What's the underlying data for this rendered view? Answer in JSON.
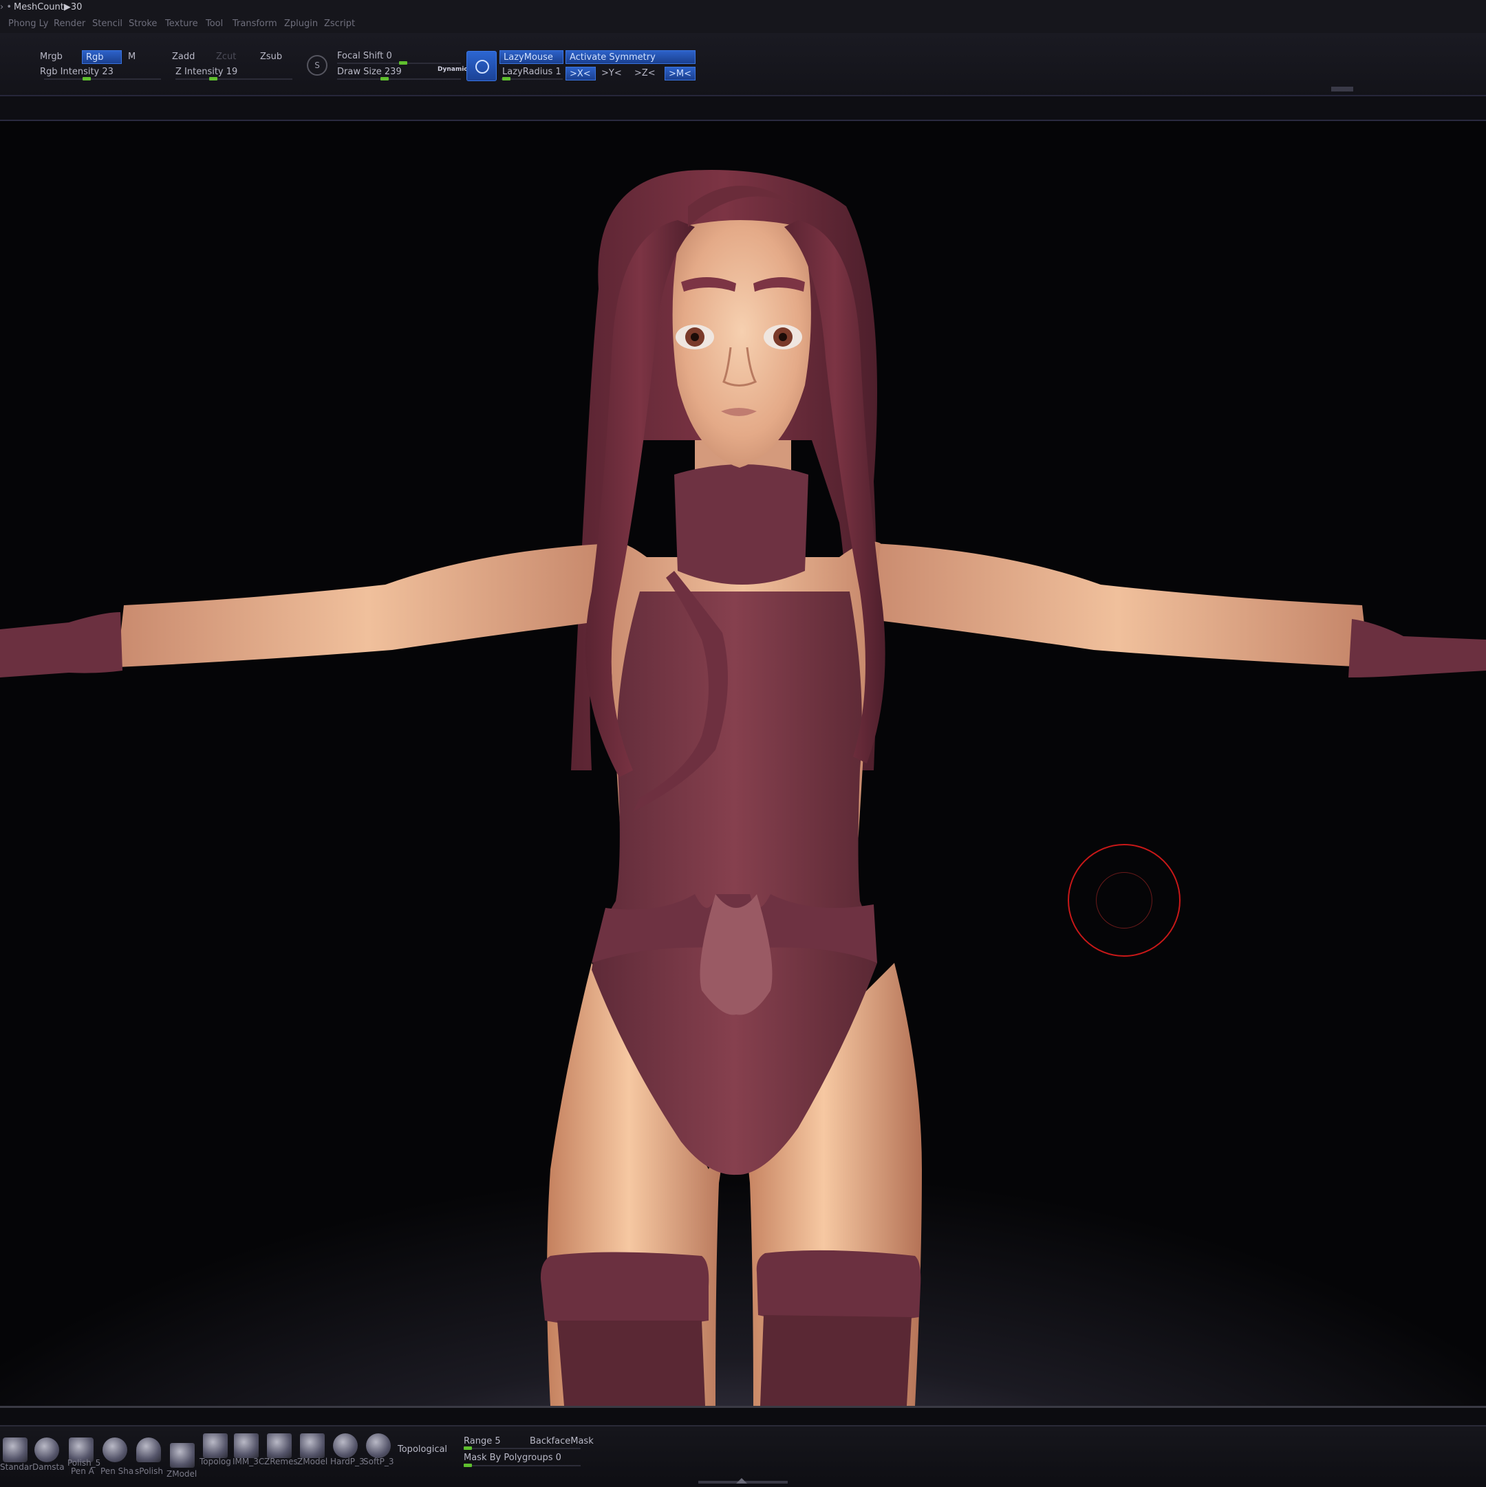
{
  "title": {
    "meshcount": "MeshCount▶30"
  },
  "menu": [
    "Phong Ly",
    "Render",
    "Stencil",
    "Stroke",
    "Texture",
    "Tool",
    "Transform",
    "Zplugin",
    "Zscript"
  ],
  "toolbar": {
    "mrgb": "Mrgb",
    "rgb": "Rgb",
    "m": "M",
    "zadd": "Zadd",
    "zcut": "Zcut",
    "zsub": "Zsub",
    "rgb_intensity": "Rgb Intensity 23",
    "z_intensity": "Z Intensity 19",
    "focal_shift": "Focal Shift 0",
    "draw_size": "Draw Size 239",
    "dynamic": "Dynamic",
    "lazymouse": "LazyMouse",
    "lazyradius": "LazyRadius 1",
    "activate_symmetry": "Activate Symmetry",
    "sym_x": ">X<",
    "sym_y": ">Y<",
    "sym_z": ">Z<",
    "sym_m": ">M<"
  },
  "sliders": {
    "rgb_intensity": 0.23,
    "z_intensity": 0.19,
    "focal_shift": 0.5,
    "draw_size": 0.2,
    "lazyradius": 0.02
  },
  "bottom": {
    "brushes": [
      "Standar",
      "Damsta",
      "Polish_5",
      "Pen A",
      "Pen Sha",
      "sPolish",
      "ZModel",
      "Topolog",
      "IMM_3C",
      "ZRemes",
      "ZModel",
      "HardP_3",
      "SoftP_3"
    ],
    "topological": "Topological",
    "range": "Range 5",
    "backfacemask": "BackfaceMask",
    "mask_by_polygroups": "Mask By Polygroups 0"
  },
  "colors": {
    "accent": "#2d62c9",
    "slider_knob": "#5fbf2e",
    "skin": "#e8b090",
    "outfit": "#7a3a48",
    "cursor": "#c81818"
  }
}
